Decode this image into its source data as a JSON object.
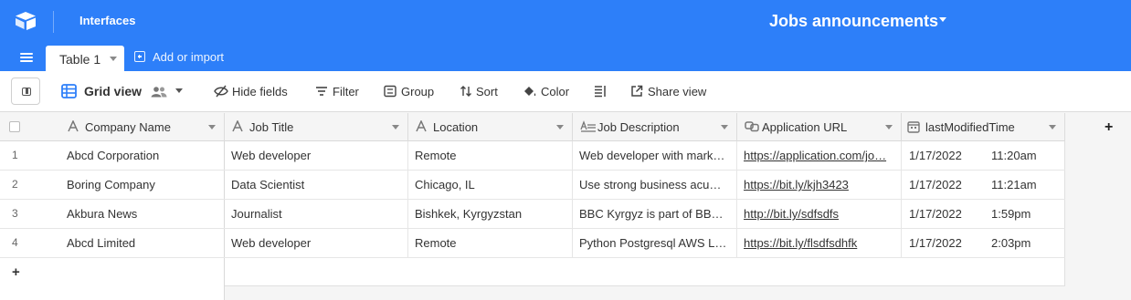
{
  "appbar": {
    "interfaces_label": "Interfaces",
    "base_title": "Jobs announcements",
    "color": "#2d7ff9"
  },
  "tabbar": {
    "tabs": [
      {
        "label": "Table 1"
      }
    ],
    "add_import_label": "Add or import"
  },
  "toolbar": {
    "view_name": "Grid view",
    "hide_fields": "Hide fields",
    "filter": "Filter",
    "group": "Group",
    "sort": "Sort",
    "color": "Color",
    "share_view": "Share view"
  },
  "grid": {
    "columns": [
      {
        "name": "Company Name",
        "type_icon": "text-type-icon"
      },
      {
        "name": "Job Title",
        "type_icon": "text-type-icon"
      },
      {
        "name": "Location",
        "type_icon": "text-type-icon"
      },
      {
        "name": "Job Description",
        "type_icon": "long-text-type-icon"
      },
      {
        "name": "Application URL",
        "type_icon": "url-type-icon"
      },
      {
        "name": "lastModifiedTime",
        "type_icon": "calendar-type-icon"
      }
    ],
    "rows": [
      {
        "num": "1",
        "company": "Abcd Corporation",
        "title": "Web developer",
        "location": "Remote",
        "description": "Web developer with mark…",
        "url": "https://application.com/jo…",
        "date": "1/17/2022",
        "time": "11:20am"
      },
      {
        "num": "2",
        "company": "Boring Company",
        "title": "Data Scientist",
        "location": "Chicago, IL",
        "description": "Use strong business acu…",
        "url": "https://bit.ly/kjh3423",
        "date": "1/17/2022",
        "time": "11:21am"
      },
      {
        "num": "3",
        "company": "Akbura News",
        "title": "Journalist",
        "location": "Bishkek, Kyrgyzstan",
        "description": "BBC Kyrgyz is part of BB…",
        "url": "http://bit.ly/sdfsdfs",
        "date": "1/17/2022",
        "time": "1:59pm"
      },
      {
        "num": "4",
        "company": "Abcd Limited",
        "title": "Web developer",
        "location": "Remote",
        "description": "Python Postgresql AWS L…",
        "url": "https://bit.ly/flsdfsdhfk",
        "date": "1/17/2022",
        "time": "2:03pm"
      }
    ],
    "add_row_symbol": "+",
    "add_column_symbol": "+"
  }
}
